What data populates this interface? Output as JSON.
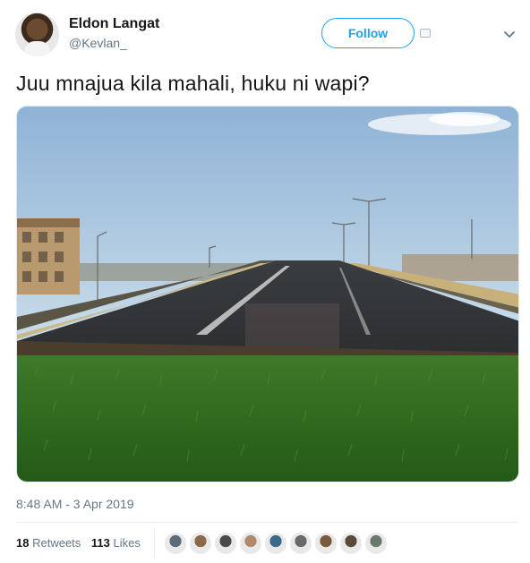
{
  "user": {
    "name": "Eldon Langat",
    "handle": "@Kevlan_"
  },
  "follow_label": "Follow",
  "tweet": {
    "text": "Juu mnajua kila mahali, huku ni wapi?",
    "timestamp": "8:48 AM - 3 Apr 2019"
  },
  "stats": {
    "retweets_count": "18",
    "retweets_label": "Retweets",
    "likes_count": "113",
    "likes_label": "Likes"
  },
  "likers": [
    "#5b6b7a",
    "#8a6a4a",
    "#4a4a4a",
    "#b08a6a",
    "#3a6a8a",
    "#6a6a6a",
    "#7a5a3a",
    "#5a4a3a",
    "#6a7a6a"
  ],
  "icons": {
    "chevron": "chevron-down-icon",
    "card": "image-card-icon"
  },
  "colors": {
    "accent": "#1da1f2",
    "muted": "#657786",
    "text": "#14171a"
  }
}
